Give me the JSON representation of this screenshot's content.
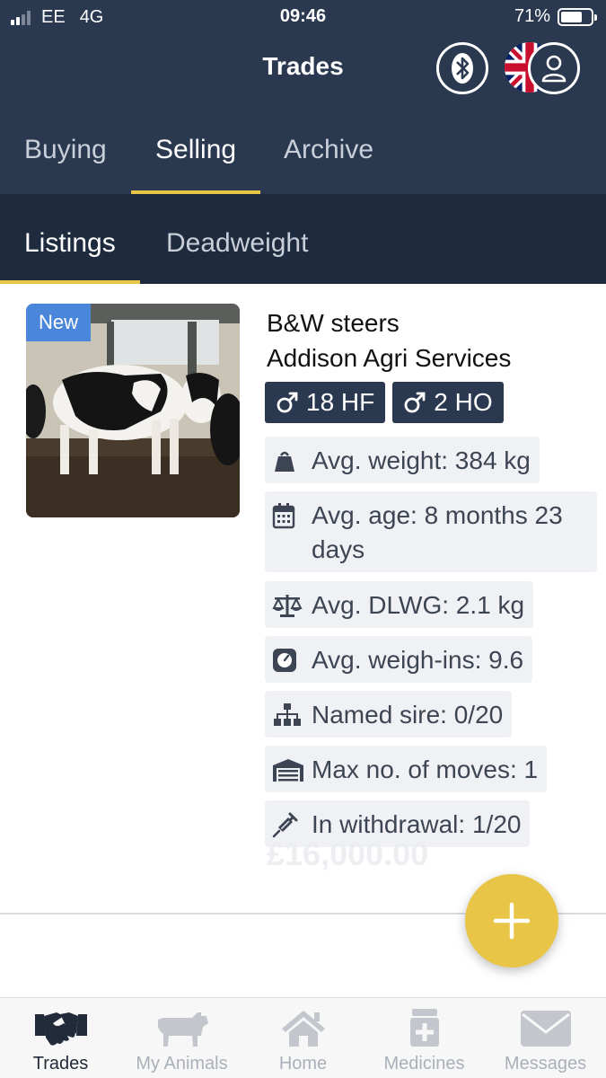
{
  "status_bar": {
    "carrier": "EE",
    "network": "4G",
    "time": "09:46",
    "battery": "71%",
    "battery_level": 0.71
  },
  "header": {
    "title": "Trades"
  },
  "main_tabs": [
    {
      "label": "Buying",
      "active": false
    },
    {
      "label": "Selling",
      "active": true
    },
    {
      "label": "Archive",
      "active": false
    }
  ],
  "sub_tabs": [
    {
      "label": "Listings",
      "active": true
    },
    {
      "label": "Deadweight",
      "active": false
    }
  ],
  "listing": {
    "badge": "New",
    "name": "B&W steers",
    "farm": "Addison Agri Services",
    "tags": [
      {
        "icon": "male-icon",
        "label": "18 HF"
      },
      {
        "icon": "male-icon",
        "label": "2 HO"
      }
    ],
    "stats": [
      {
        "icon": "weight-bag-icon",
        "label": "Avg. weight: 384 kg"
      },
      {
        "icon": "calendar-icon",
        "label": "Avg. age: 8 months 23 days"
      },
      {
        "icon": "balance-scale-icon",
        "label": "Avg. DLWG: 2.1 kg"
      },
      {
        "icon": "weighing-scale-icon",
        "label": "Avg. weigh-ins: 9.6"
      },
      {
        "icon": "sitemap-icon",
        "label": "Named sire: 0/20"
      },
      {
        "icon": "warehouse-icon",
        "label": "Max no. of moves: 1"
      },
      {
        "icon": "syringe-icon",
        "label": "In withdrawal: 1/20"
      }
    ],
    "price": "£16,000.00"
  },
  "bottom_nav": [
    {
      "label": "Trades",
      "icon": "handshake-icon",
      "active": true
    },
    {
      "label": "My Animals",
      "icon": "cow-icon",
      "active": false
    },
    {
      "label": "Home",
      "icon": "home-icon",
      "active": false
    },
    {
      "label": "Medicines",
      "icon": "medicine-icon",
      "active": false
    },
    {
      "label": "Messages",
      "icon": "envelope-icon",
      "active": false
    }
  ],
  "colors": {
    "header_bg": "#2b3950",
    "subtab_bg": "#1e2a3d",
    "accent": "#e8c547",
    "badge_blue": "#4a86d9"
  }
}
